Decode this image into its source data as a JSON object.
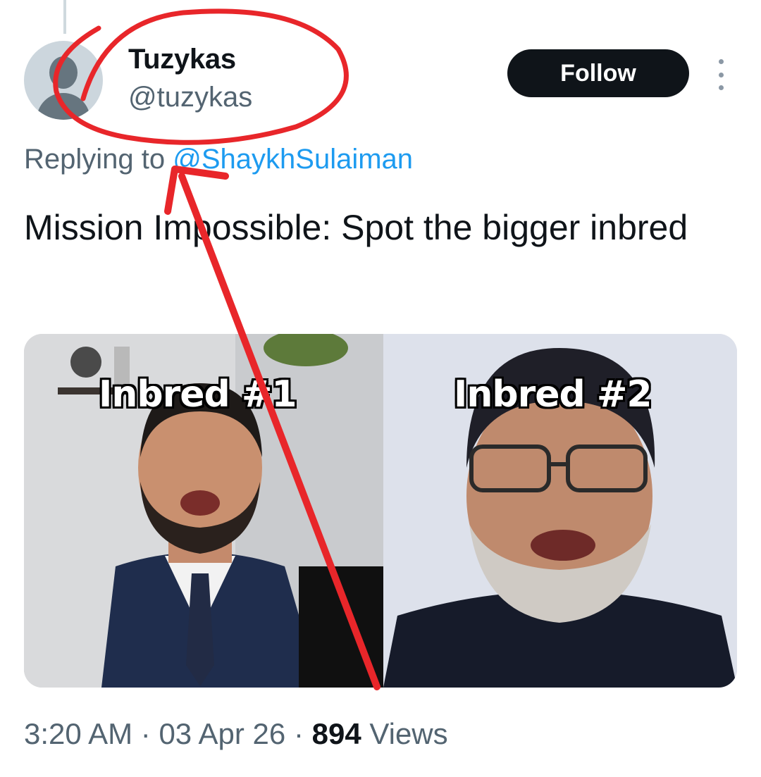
{
  "tweet": {
    "author": {
      "display_name": "Tuzykas",
      "handle": "@tuzykas"
    },
    "follow_label": "Follow",
    "replying_prefix": "Replying to",
    "replying_to": "@ShaykhSulaiman",
    "text": "Mission Impossible: Spot the bigger inbred",
    "media": {
      "left_caption": "Inbred #1",
      "right_caption": "Inbred #2"
    },
    "time": "3:20 AM",
    "date": "03 Apr 26",
    "views_count": "894",
    "views_label": "Views",
    "separator": "·"
  },
  "colors": {
    "secondary_text": "#536471",
    "link": "#1d9bf0",
    "annotation_red": "#e8262a",
    "follow_bg": "#0f1419"
  },
  "icons": {
    "more": "more-vertical-icon",
    "avatar": "default-avatar-icon"
  }
}
